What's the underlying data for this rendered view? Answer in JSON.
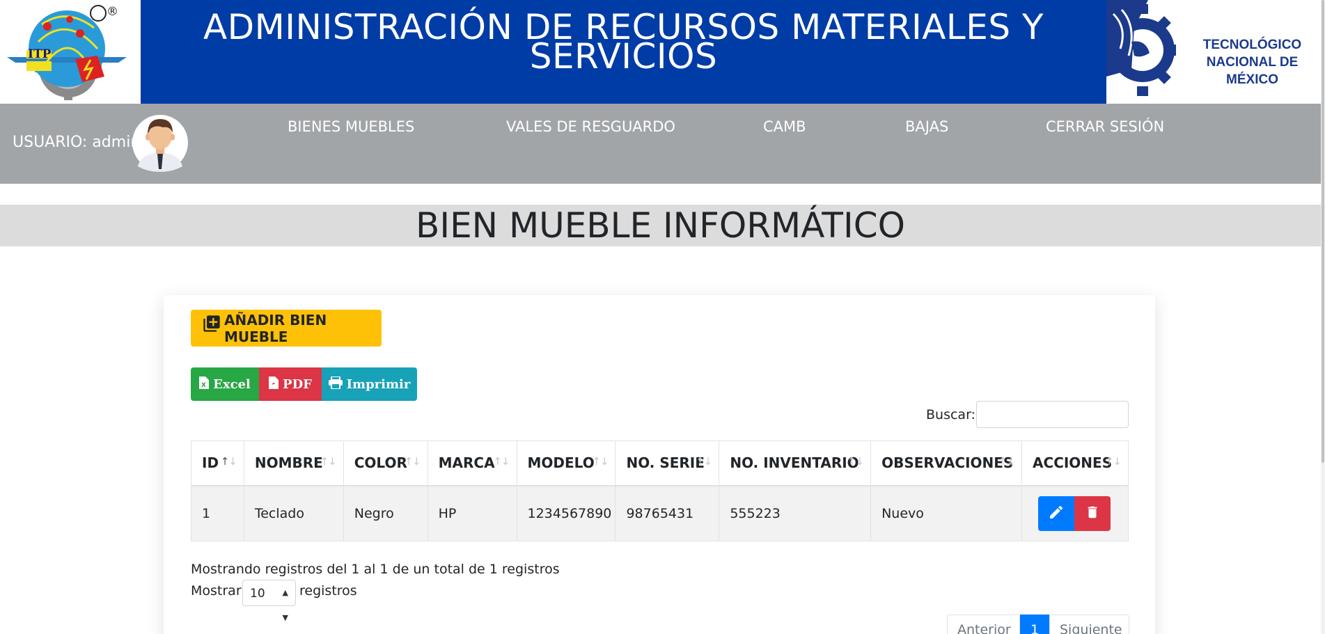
{
  "header": {
    "title": "ADMINISTRACIÓN DE RECURSOS MATERIALES Y SERVICIOS",
    "left_logo_text": "ITP",
    "registered_mark": "®",
    "right_logo_text": "TECNOLÓGICO NACIONAL DE MÉXICO"
  },
  "nav": {
    "user_label": "USUARIO: admin",
    "items": [
      "BIENES MUEBLES",
      "VALES DE RESGUARDO",
      "CAMB",
      "BAJAS",
      "CERRAR SESIÓN"
    ]
  },
  "page": {
    "title": "BIEN MUEBLE INFORMÁTICO",
    "add_button": "AÑADIR BIEN MUEBLE",
    "export_buttons": {
      "excel": "Excel",
      "pdf": "PDF",
      "print": "Imprimir"
    },
    "search_label": "Buscar:",
    "search_value": ""
  },
  "table": {
    "columns": [
      "ID",
      "NOMBRE",
      "COLOR",
      "MARCA",
      "MODELO",
      "NO. SERIE",
      "NO. INVENTARIO",
      "OBSERVACIONES",
      "ACCIONES"
    ],
    "rows": [
      [
        "1",
        "Teclado",
        "Negro",
        "HP",
        "1234567890",
        "98765431",
        "555223",
        "Nuevo"
      ]
    ]
  },
  "footer": {
    "info": "Mostrando registros del 1 al 1 de un total de 1 registros",
    "show_label": "Mostrar",
    "show_value": "10",
    "show_suffix": "registros",
    "pagination": {
      "prev": "Anterior",
      "current": "1",
      "next": "Siguiente"
    }
  },
  "colors": {
    "header_blue": "#003ca6",
    "nav_gray": "#a2a5a8",
    "warning": "#ffc107",
    "success": "#28a745",
    "danger": "#dc3545",
    "info": "#17a2b8",
    "primary": "#007bff"
  },
  "icons": {
    "add": "add-box-icon",
    "excel": "excel-file-icon",
    "pdf": "pdf-file-icon",
    "print": "printer-icon",
    "edit": "pencil-icon",
    "delete": "trash-icon",
    "sort": "sort-arrows-icon"
  }
}
